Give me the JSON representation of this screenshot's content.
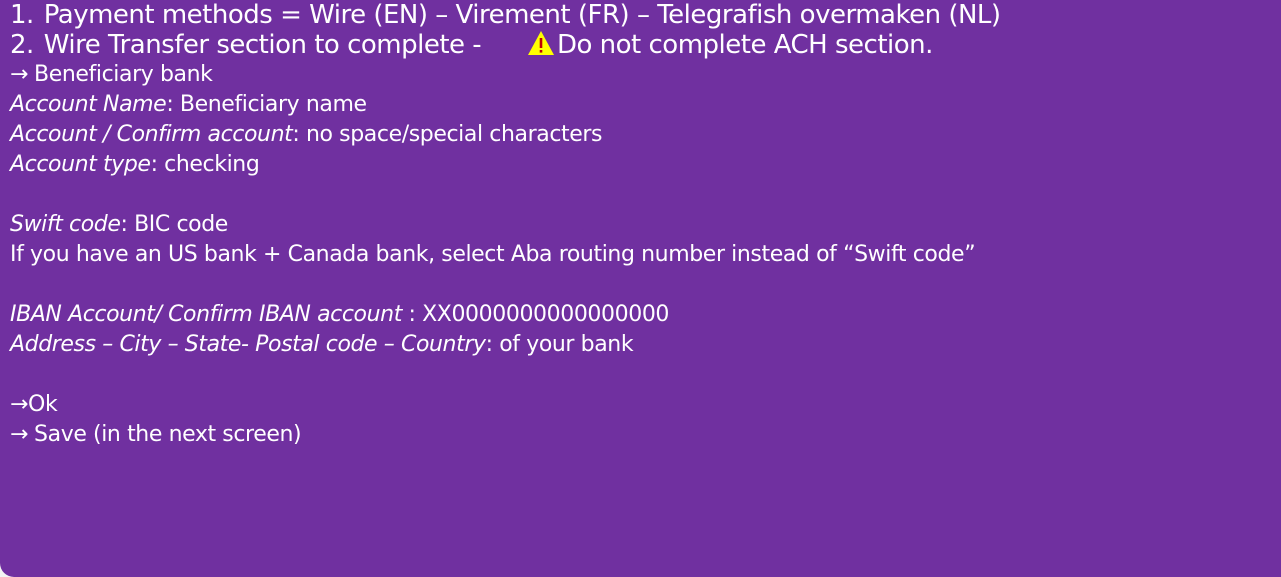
{
  "steps": [
    {
      "num": "1.",
      "text": "Payment methods = Wire (EN) – Virement (FR) – Telegrafish overmaken (NL)"
    },
    {
      "num": "2.",
      "text": "Wire Transfer section to complete -",
      "warning": "Do not complete ACH section."
    }
  ],
  "beneficiary_heading": "Beneficiary bank",
  "fields": {
    "account_name": {
      "label": "Account Name",
      "value": ": Beneficiary name"
    },
    "account_confirm": {
      "label": "Account / Confirm account",
      "value": ": no space/special characters"
    },
    "account_type": {
      "label": "Account type",
      "value": ": checking"
    },
    "swift": {
      "label": "Swift code",
      "value": ": BIC code"
    },
    "swift_note": "If you have an US bank + Canada bank, select Aba routing number instead of “Swift code”",
    "iban": {
      "label": "IBAN Account/ Confirm IBAN account",
      "value": " : XX0000000000000000"
    },
    "address": {
      "label": "Address – City – State- Postal code – Country",
      "value": ": of your bank"
    }
  },
  "actions": {
    "ok": "Ok",
    "save": "Save (in the next screen)"
  },
  "colors": {
    "background": "#7030a0",
    "text": "#ffffff",
    "warning_fill": "#ffff00"
  },
  "icons": {
    "arrow": "right-arrow-icon",
    "warning": "warning-triangle-icon"
  }
}
